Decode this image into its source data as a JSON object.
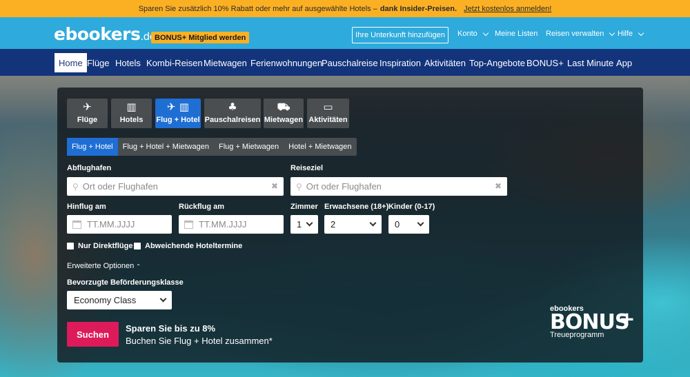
{
  "promo": {
    "text": "Sparen Sie zusätzlich 10% Rabatt oder mehr auf ausgewählte Hotels –",
    "bold": "dank Insider-Preisen.",
    "link": "Jetzt kostenlos anmelden!"
  },
  "header": {
    "logo": "ebookers",
    "logo_tld": ".de",
    "bonus_badge": "BONUS+ Mitglied werden",
    "add_property": "Ihre Unterkunft hinzufügen",
    "konto": "Konto",
    "listen": "Meine Listen",
    "reisen": "Reisen verwalten",
    "hilfe": "Hilfe"
  },
  "nav": {
    "items": [
      "Home",
      "Flüge",
      "Hotels",
      "Kombi-Reisen",
      "Mietwagen",
      "Ferienwohnungen",
      "Pauschalreise",
      "Inspiration",
      "Aktivitäten",
      "Top-Angebote",
      "BONUS+",
      "Last Minute",
      "App"
    ],
    "active": "Home"
  },
  "search": {
    "tabs": [
      {
        "label": "Flüge",
        "icon": "plane-icon"
      },
      {
        "label": "Hotels",
        "icon": "building-icon"
      },
      {
        "label": "Flug + Hotel",
        "icon": "plane-building-icon"
      },
      {
        "label": "Pauschalreisen",
        "icon": "palm-icon"
      },
      {
        "label": "Mietwagen",
        "icon": "car-icon"
      },
      {
        "label": "Aktivitäten",
        "icon": "ticket-icon"
      }
    ],
    "active_tab": "Flug + Hotel",
    "subtabs": [
      "Flug + Hotel",
      "Flug + Hotel + Mietwagen",
      "Flug + Mietwagen",
      "Hotel + Mietwagen"
    ],
    "active_subtab": "Flug + Hotel",
    "origin": {
      "label": "Abflughafen",
      "placeholder": "Ort oder Flughafen"
    },
    "destination": {
      "label": "Reiseziel",
      "placeholder": "Ort oder Flughafen"
    },
    "depart": {
      "label": "Hinflug am",
      "placeholder": "TT.MM.JJJJ"
    },
    "return": {
      "label": "Rückflug am",
      "placeholder": "TT.MM.JJJJ"
    },
    "rooms": {
      "label": "Zimmer",
      "value": "1"
    },
    "adults": {
      "label": "Erwachsene (18+)",
      "value": "2"
    },
    "children": {
      "label": "Kinder (0-17)",
      "value": "0"
    },
    "direct_only": "Nur Direktflüge",
    "different_hotel_dates": "Abweichende Hoteltermine",
    "advanced": "Erweiterte Optionen",
    "cabin_class": {
      "label": "Bevorzugte Beförderungsklasse",
      "value": "Economy Class"
    },
    "submit": "Suchen",
    "save_title": "Sparen Sie bis zu 8%",
    "save_text": "Buchen Sie Flug + Hotel zusammen*"
  },
  "bonus_logo": {
    "brand": "ebookers",
    "name": "BONUS",
    "plus": "+",
    "tagline": "Treueprogramm"
  }
}
